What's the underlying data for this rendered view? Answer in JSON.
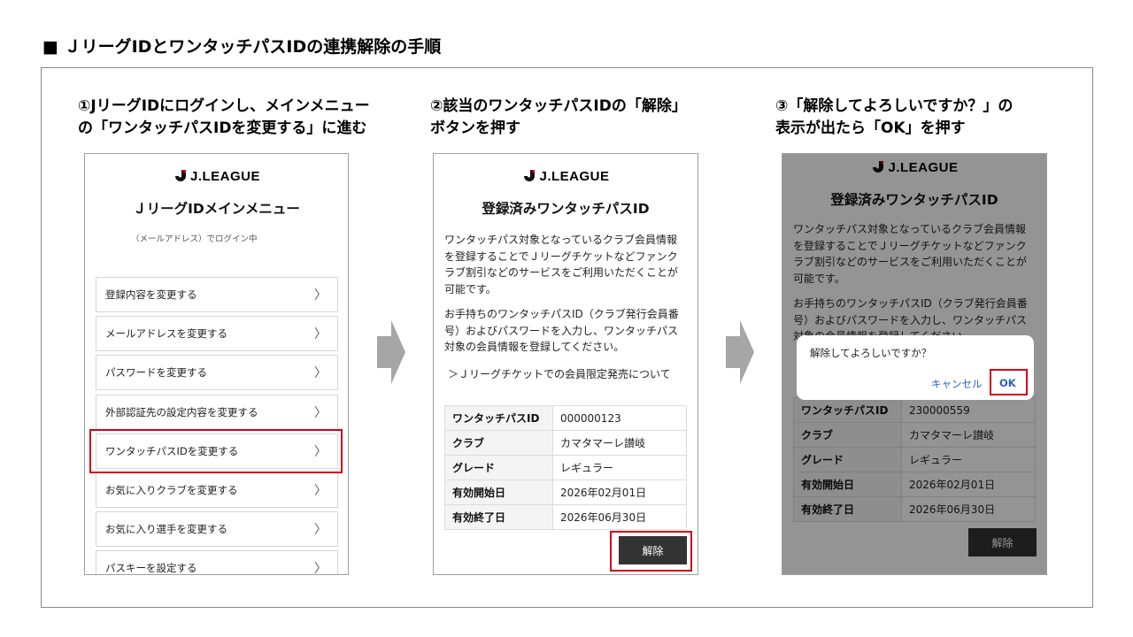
{
  "page_title": "■ ＪリーグIDとワンタッチパスIDの連携解除の手順",
  "steps": [
    {
      "line1": "①JリーグIDにログインし、メインメニュー",
      "line2": "の「ワンタッチパスIDを変更する」に進む"
    },
    {
      "line1": "②該当のワンタッチパスIDの「解除」",
      "line2": "ボタンを押す"
    },
    {
      "line1": "③「解除してよろしいですか？」の",
      "line2": "表示が出たら「OK」を押す"
    }
  ],
  "logo_text": "J.LEAGUE",
  "screen1": {
    "title": "ＪリーグIDメインメニュー",
    "mail_note": "（メールアドレス）でログイン中",
    "menu_items": [
      "登録内容を変更する",
      "メールアドレスを変更する",
      "パスワードを変更する",
      "外部認証先の設定内容を変更する",
      "ワンタッチパスIDを変更する",
      "お気に入りクラブを変更する",
      "お気に入り選手を変更する",
      "パスキーを設定する"
    ],
    "chevron": "〉"
  },
  "screen2": {
    "title": "登録済みワンタッチパスID",
    "para1": [
      "ワンタッチパス対象となっているクラブ会員情報",
      "を登録することでＪリーグチケットなどファンク",
      "ラブ割引などのサービスをご利用いただくことが",
      "可能です。"
    ],
    "para2": [
      "お手持ちのワンタッチパスID（クラブ発行会員番",
      "号）およびパスワードを入力し、ワンタッチパス",
      "対象の会員情報を登録してください。"
    ],
    "link": "＞Ｊリーグチケットでの会員限定発売について",
    "table": [
      {
        "k": "ワンタッチパスID",
        "v": "000000123"
      },
      {
        "k": "クラブ",
        "v": "カマタマーレ讃岐"
      },
      {
        "k": "グレード",
        "v": "レギュラー"
      },
      {
        "k": "有効開始日",
        "v": "2026年02月01日"
      },
      {
        "k": "有効終了日",
        "v": "2026年06月30日"
      }
    ],
    "release_button": "解除"
  },
  "screen3": {
    "title": "登録済みワンタッチパスID",
    "para1": [
      "ワンタッチパス対象となっているクラブ会員情報",
      "を登録することでＪリーグチケットなどファンク",
      "ラブ割引などのサービスをご利用いただくことが",
      "可能です。"
    ],
    "para2": [
      "お手持ちのワンタッチパスID（クラブ発行会員番",
      "号）およびパスワードを入力し、ワンタッチパス",
      "対象の会員情報を登録してください。"
    ],
    "table": [
      {
        "k": "ワンタッチパスID",
        "v": "230000559"
      },
      {
        "k": "クラブ",
        "v": "カマタマーレ讃岐"
      },
      {
        "k": "グレード",
        "v": "レギュラー"
      },
      {
        "k": "有効開始日",
        "v": "2026年02月01日"
      },
      {
        "k": "有効終了日",
        "v": "2026年06月30日"
      }
    ],
    "release_button": "解除",
    "dialog": {
      "message": "解除してよろしいですか？",
      "cancel": "キャンセル",
      "ok": "OK"
    }
  },
  "colors": {
    "highlight": "#d0021b",
    "dialog_link": "#2a62c9",
    "arrow": "#a6a6a6",
    "button_dark": "#333333"
  }
}
